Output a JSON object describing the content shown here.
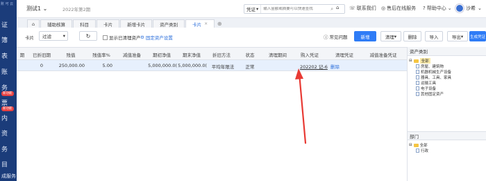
{
  "sidebar": {
    "logo_text": "账 可 云",
    "items": [
      "证",
      "簿",
      "表",
      "账",
      "务",
      "票",
      "内",
      "资",
      "务",
      "目",
      "成服务"
    ],
    "badges": [
      "新功能",
      "新功能"
    ]
  },
  "topbar": {
    "company": "测试1",
    "period": "2022年第2期",
    "search_type": "凭证",
    "search_placeholder": "输入金额或摘要可以快速查找",
    "contact_label": "联系我们",
    "service_label": "售后在线服务",
    "help_label": "帮助中心",
    "user_name": "沙希"
  },
  "tabs": [
    {
      "label": "辅助核算",
      "active": false
    },
    {
      "label": "科目",
      "active": false
    },
    {
      "label": "卡片",
      "active": false
    },
    {
      "label": "新增卡片",
      "active": false
    },
    {
      "label": "资产类别",
      "active": false
    },
    {
      "label": "卡片",
      "active": true
    }
  ],
  "toolbar": {
    "period_label": "卡片",
    "filter_value": "过滤",
    "show_cleared_label": "显示已清理资产",
    "fixed_asset_settings_label": "固定资产设置",
    "faq_label": "常见问题",
    "buttons": {
      "add": "新增",
      "clear": "清理",
      "delete": "删除",
      "import": "导入",
      "export": "导出",
      "generate_voucher": "生成凭证"
    }
  },
  "table": {
    "headers": [
      "期",
      "已折旧期",
      "残值",
      "残值率%",
      "减值准备",
      "期初净值",
      "期末净值",
      "折旧方法",
      "状态",
      "清理期间",
      "购入凭证",
      "清理凭证",
      "减值准备凭证"
    ],
    "rows": [
      {
        "cells": [
          "",
          "0",
          "250,000.00",
          "5.00",
          "",
          "5,000,000.0(",
          "5,000,000.0(",
          "平均年限法",
          "正常",
          "",
          "202202 记-6",
          "",
          ""
        ],
        "delete_link": "删除"
      }
    ]
  },
  "asset_category": {
    "title": "资产类别",
    "root": "全部",
    "children": [
      "房屋、建筑物",
      "机器机械生产设备",
      "器具、工具、家具",
      "运输工具",
      "电子设备",
      "其他固定资产"
    ]
  },
  "department": {
    "title": "部门",
    "root": "全部",
    "children": [
      "行政"
    ]
  },
  "colors": {
    "primary": "#2f7cf6",
    "sidebar": "#1b3c7a",
    "arrow": "#e83a34"
  }
}
